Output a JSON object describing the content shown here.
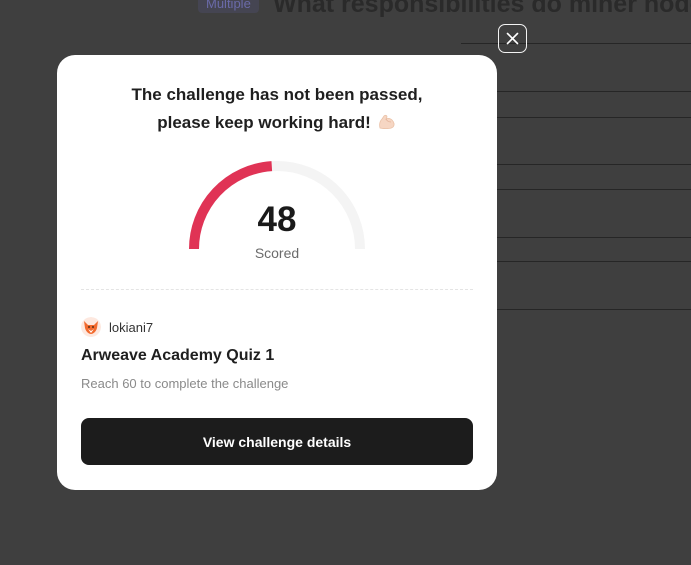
{
  "background": {
    "tag": "Multiple",
    "question": "What responsibilities do miner nodes"
  },
  "modal": {
    "headline_line1": "The challenge has not been passed,",
    "headline_line2": "please keep working hard!",
    "headline_icon": "flexed-biceps-icon",
    "score": {
      "value": 48,
      "display": "48",
      "label": "Scored",
      "passing": 60,
      "max": 100
    },
    "author": {
      "avatar_icon": "fox-avatar-icon",
      "username": "lokiani7"
    },
    "quiz_title": "Arweave Academy Quiz 1",
    "requirement": "Reach 60 to complete the challenge",
    "button_label": "View challenge details",
    "close_icon": "close-icon"
  },
  "colors": {
    "gauge_fill": "#e03355",
    "gauge_track": "#f4f4f4",
    "button_bg": "#1c1c1c",
    "overlay": "#3f3f3f"
  }
}
